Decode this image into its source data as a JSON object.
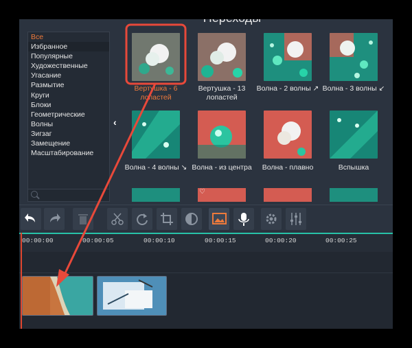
{
  "panel": {
    "title": "Переходы"
  },
  "categories": [
    {
      "label": "Все",
      "active": true
    },
    {
      "label": "Избранное"
    },
    {
      "label": "Популярные"
    },
    {
      "label": "Художественные"
    },
    {
      "label": "Угасание"
    },
    {
      "label": "Размытие"
    },
    {
      "label": "Круги"
    },
    {
      "label": "Блоки"
    },
    {
      "label": "Геометрические"
    },
    {
      "label": "Волны"
    },
    {
      "label": "Зигзаг"
    },
    {
      "label": "Замещение"
    },
    {
      "label": "Масштабирование"
    }
  ],
  "transitions": [
    {
      "label": "Вертушка - 6 лопастей",
      "active": true,
      "icon": "flower-thumbnail"
    },
    {
      "label": "Вертушка - 13 лопастей",
      "icon": "flower-thumbnail"
    },
    {
      "label": "Волна - 2 волны ↗",
      "icon": "flower-thumbnail"
    },
    {
      "label": "Волна - 3 волны ↙",
      "icon": "flower-thumbnail"
    },
    {
      "label": "Волна - 4 волны ↘",
      "icon": "drop-thumbnail"
    },
    {
      "label": "Волна - из центра",
      "icon": "drop-thumbnail"
    },
    {
      "label": "Волна - плавно",
      "icon": "flower-thumbnail"
    },
    {
      "label": "Вспышка",
      "icon": "drop-thumbnail"
    }
  ],
  "toolbar": {
    "buttons": [
      "undo-icon",
      "redo-icon",
      "delete-icon",
      "cut-icon",
      "rotate-icon",
      "crop-icon",
      "color-adjust-icon",
      "image-icon",
      "microphone-icon",
      "settings-icon",
      "equalizer-icon"
    ]
  },
  "timeline": {
    "ticks": [
      "00:00:00",
      "00:00:05",
      "00:00:10",
      "00:00:15",
      "00:00:20",
      "00:00:25"
    ],
    "clips": [
      "beach-clip",
      "office-desk-clip"
    ]
  },
  "colors": {
    "accent": "#ef7a3b",
    "highlight": "#e8493a",
    "playhead": "#e0452e",
    "ruler_line": "#27c2a8"
  }
}
